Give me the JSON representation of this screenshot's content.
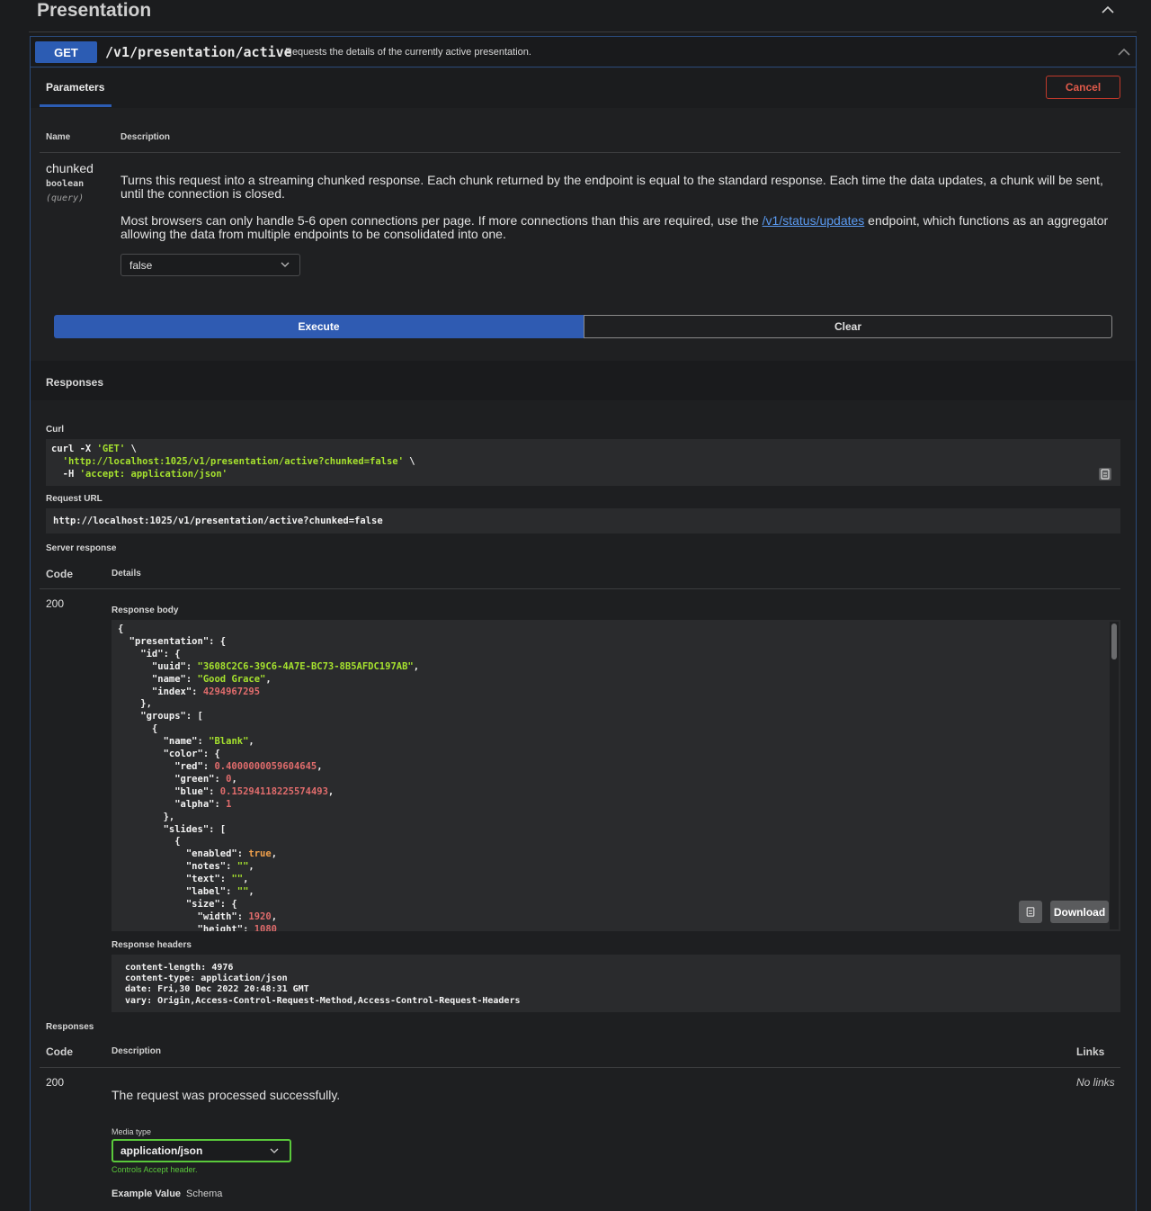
{
  "section": {
    "title": "Presentation"
  },
  "op": {
    "method": "GET",
    "path": "/v1/presentation/active",
    "summary": "Requests the details of the currently active presentation."
  },
  "tabs": {
    "parameters": "Parameters",
    "cancel": "Cancel"
  },
  "params_table": {
    "col_name": "Name",
    "col_description": "Description",
    "param": {
      "name": "chunked",
      "type": "boolean",
      "in": "(query)",
      "desc1": "Turns this request into a streaming chunked response. Each chunk returned by the endpoint is equal to the standard response. Each time the data updates, a chunk will be sent, until the connection is closed.",
      "desc2_before": "Most browsers can only handle 5-6 open connections per page. If more connections than this are required, use the ",
      "desc2_link": "/v1/status/updates",
      "desc2_after": " endpoint, which functions as an aggregator allowing the data from multiple endpoints to be consolidated into one.",
      "value": "false"
    }
  },
  "buttons": {
    "execute": "Execute",
    "clear": "Clear"
  },
  "responses": {
    "title": "Responses",
    "curl_label": "Curl",
    "curl_line1": "curl -X ",
    "curl_get": "'GET'",
    "curl_bs": " \\",
    "curl_url": "'http://localhost:1025/v1/presentation/active?chunked=false'",
    "curl_h": "-H ",
    "curl_accept": "'accept: application/json'",
    "request_url_label": "Request URL",
    "request_url": "http://localhost:1025/v1/presentation/active?chunked=false",
    "server_response_label": "Server response",
    "col_code": "Code",
    "col_details": "Details",
    "code": "200",
    "body_label": "Response body",
    "download": "Download",
    "headers_label": "Response headers",
    "headers": [
      "content-length: 4976",
      "content-type: application/json",
      "date: Fri,30 Dec 2022 20:48:31 GMT",
      "vary: Origin,Access-Control-Request-Method,Access-Control-Request-Headers"
    ]
  },
  "body_json": {
    "uuid": "\"3608C2C6-39C6-4A7E-BC73-8B5AFDC197AB\"",
    "name": "\"Good Grace\"",
    "index": "4294967295",
    "group_name": "\"Blank\"",
    "red": "0.4000000059604645",
    "green": "0",
    "blue": "0.15294118225574493",
    "alpha": "1",
    "enabled": "true",
    "notes": "\"\"",
    "text": "\"\"",
    "label": "\"\"",
    "width": "1920",
    "height": "1080"
  },
  "responses2": {
    "title": "Responses",
    "col_code": "Code",
    "col_description": "Description",
    "col_links": "Links",
    "code": "200",
    "description": "The request was processed successfully.",
    "links": "No links",
    "media_label": "Media type",
    "media_value": "application/json",
    "media_hint": "Controls Accept header.",
    "example_value": "Example Value",
    "schema": "Schema"
  },
  "colors": {
    "accent": "#2c5cb3",
    "danger": "#c0392b",
    "success": "#5ac93b"
  }
}
